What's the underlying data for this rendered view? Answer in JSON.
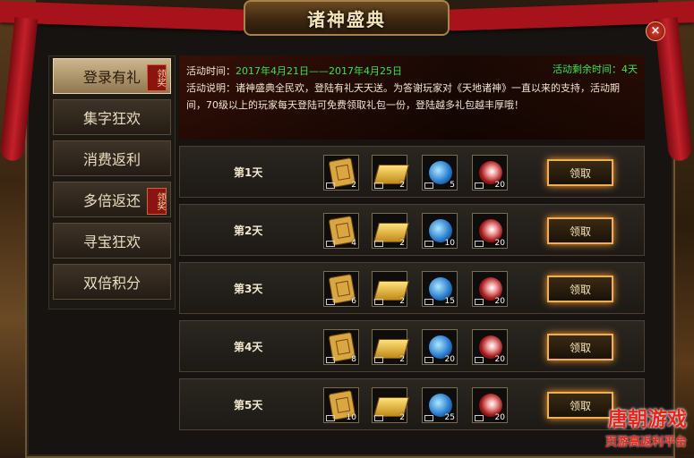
{
  "window": {
    "title": "诸神盛典",
    "close": "×"
  },
  "sidebar": {
    "tabs": [
      {
        "label": "登录有礼",
        "badge": "领奖",
        "active": true
      },
      {
        "label": "集字狂欢",
        "badge": "",
        "active": false
      },
      {
        "label": "消费返利",
        "badge": "",
        "active": false
      },
      {
        "label": "多倍返还",
        "badge": "领奖",
        "active": false
      },
      {
        "label": "寻宝狂欢",
        "badge": "",
        "active": false
      },
      {
        "label": "双倍积分",
        "badge": "",
        "active": false
      }
    ]
  },
  "event": {
    "time_label": "活动时间：",
    "time_value": "2017年4月21日——2017年4月25日",
    "remaining": "活动剩余时间：4天",
    "desc_label": "活动说明：",
    "desc_text": "诸神盛典全民欢，登陆有礼天天送。为答谢玩家对《天地诸神》一直以来的支持，活动期间，70级以上的玩家每天登陆可免费领取礼包一份，登陆越多礼包越丰厚哦！"
  },
  "rows": [
    {
      "day": "第1天",
      "items": [
        "2",
        "2",
        "5",
        "20"
      ],
      "button": "领取"
    },
    {
      "day": "第2天",
      "items": [
        "4",
        "2",
        "10",
        "20"
      ],
      "button": "领取"
    },
    {
      "day": "第3天",
      "items": [
        "6",
        "2",
        "15",
        "20"
      ],
      "button": "领取"
    },
    {
      "day": "第4天",
      "items": [
        "8",
        "2",
        "20",
        "20"
      ],
      "button": "领取"
    },
    {
      "day": "第5天",
      "items": [
        "10",
        "2",
        "25",
        "20"
      ],
      "button": "领取"
    }
  ],
  "item_icons": [
    "scroll-icon",
    "gold-bars-icon",
    "blue-orb-icon",
    "red-orb-icon"
  ],
  "watermark": {
    "line1": "唐朝游戏",
    "line2": "页游高返利平台"
  },
  "colors": {
    "accent_red": "#a8121a",
    "green_text": "#3ee04a",
    "gold_border": "#f0b050"
  }
}
